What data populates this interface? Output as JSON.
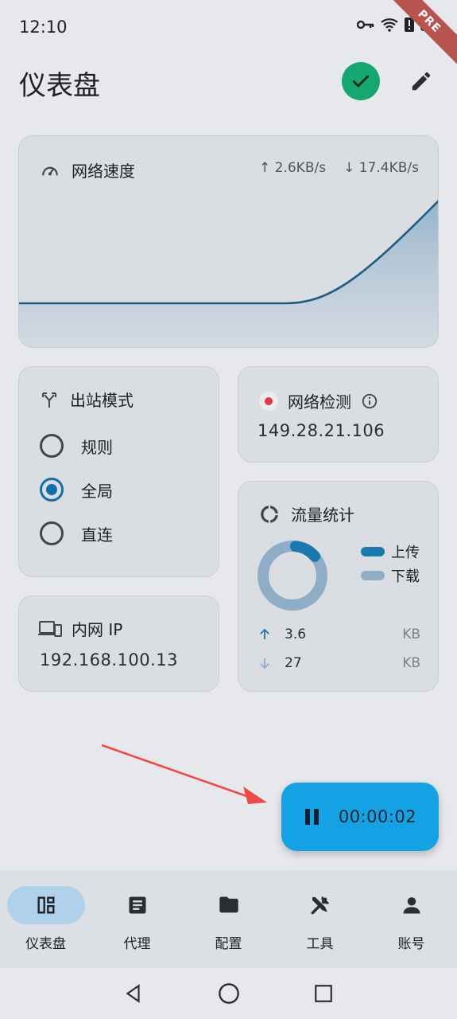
{
  "status_bar": {
    "time": "12:10",
    "ribbon": "PRE"
  },
  "header": {
    "title": "仪表盘"
  },
  "speed_card": {
    "title": "网络速度",
    "upload": "↑ 2.6KB/s",
    "download": "↓ 17.4KB/s"
  },
  "mode_card": {
    "title": "出站模式",
    "options": [
      {
        "label": "规则",
        "selected": false
      },
      {
        "label": "全局",
        "selected": true
      },
      {
        "label": "直连",
        "selected": false
      }
    ]
  },
  "ip_card": {
    "title": "内网 IP",
    "value": "192.168.100.13"
  },
  "network_card": {
    "title": "网络检测",
    "value": "149.28.21.106"
  },
  "traffic_card": {
    "title": "流量统计",
    "legend_upload": "上传",
    "legend_download": "下载",
    "upload_value": "3.6",
    "upload_unit": "KB",
    "download_value": "27",
    "download_unit": "KB",
    "upload_fraction": 0.12
  },
  "timer": {
    "value": "00:00:02"
  },
  "bottom_nav": {
    "items": [
      {
        "label": "仪表盘",
        "icon": "dashboard-icon",
        "active": true
      },
      {
        "label": "代理",
        "icon": "article-icon",
        "active": false
      },
      {
        "label": "配置",
        "icon": "folder-icon",
        "active": false
      },
      {
        "label": "工具",
        "icon": "tools-icon",
        "active": false
      },
      {
        "label": "账号",
        "icon": "person-icon",
        "active": false
      }
    ]
  },
  "colors": {
    "accent": "#126ea6",
    "success": "#16a672",
    "fab": "#14a2e4",
    "upload": "#1a7ab0",
    "download": "#8faec6",
    "error_dot": "#e03a4a"
  }
}
